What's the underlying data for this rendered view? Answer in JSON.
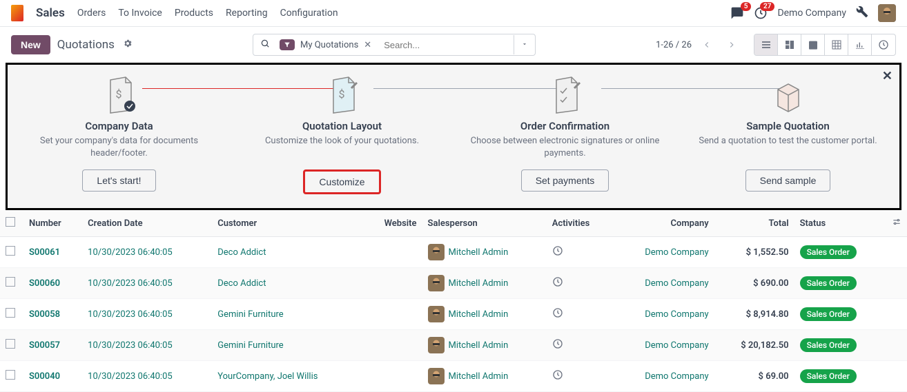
{
  "nav": {
    "app": "Sales",
    "links": [
      "Orders",
      "To Invoice",
      "Products",
      "Reporting",
      "Configuration"
    ],
    "msg_badge": "5",
    "activity_badge": "27",
    "company": "Demo Company"
  },
  "toolbar": {
    "new_label": "New",
    "breadcrumb": "Quotations",
    "filter_label": "My Quotations",
    "search_placeholder": "Search...",
    "pager": "1-26 / 26"
  },
  "onboard": {
    "steps": [
      {
        "title": "Company Data",
        "desc": "Set your company's data for documents header/footer.",
        "btn": "Let's start!"
      },
      {
        "title": "Quotation Layout",
        "desc": "Customize the look of your quotations.",
        "btn": "Customize"
      },
      {
        "title": "Order Confirmation",
        "desc": "Choose between electronic signatures or online payments.",
        "btn": "Set payments"
      },
      {
        "title": "Sample Quotation",
        "desc": "Send a quotation to test the customer portal.",
        "btn": "Send sample"
      }
    ]
  },
  "table": {
    "headers": {
      "number": "Number",
      "date": "Creation Date",
      "customer": "Customer",
      "website": "Website",
      "salesperson": "Salesperson",
      "activities": "Activities",
      "company": "Company",
      "total": "Total",
      "status": "Status"
    },
    "rows": [
      {
        "num": "S00061",
        "date": "10/30/2023 06:40:05",
        "cust": "Deco Addict",
        "sp": "Mitchell Admin",
        "comp": "Demo Company",
        "total": "$ 1,552.50",
        "status": "Sales Order"
      },
      {
        "num": "S00060",
        "date": "10/30/2023 06:40:05",
        "cust": "Deco Addict",
        "sp": "Mitchell Admin",
        "comp": "Demo Company",
        "total": "$ 690.00",
        "status": "Sales Order"
      },
      {
        "num": "S00058",
        "date": "10/30/2023 06:40:05",
        "cust": "Gemini Furniture",
        "sp": "Mitchell Admin",
        "comp": "Demo Company",
        "total": "$ 8,914.80",
        "status": "Sales Order"
      },
      {
        "num": "S00057",
        "date": "10/30/2023 06:40:05",
        "cust": "Gemini Furniture",
        "sp": "Mitchell Admin",
        "comp": "Demo Company",
        "total": "$ 20,182.50",
        "status": "Sales Order"
      },
      {
        "num": "S00040",
        "date": "10/30/2023 06:40:05",
        "cust": "YourCompany, Joel Willis",
        "sp": "Mitchell Admin",
        "comp": "Demo Company",
        "total": "$ 69.00",
        "status": "Sales Order"
      }
    ]
  }
}
